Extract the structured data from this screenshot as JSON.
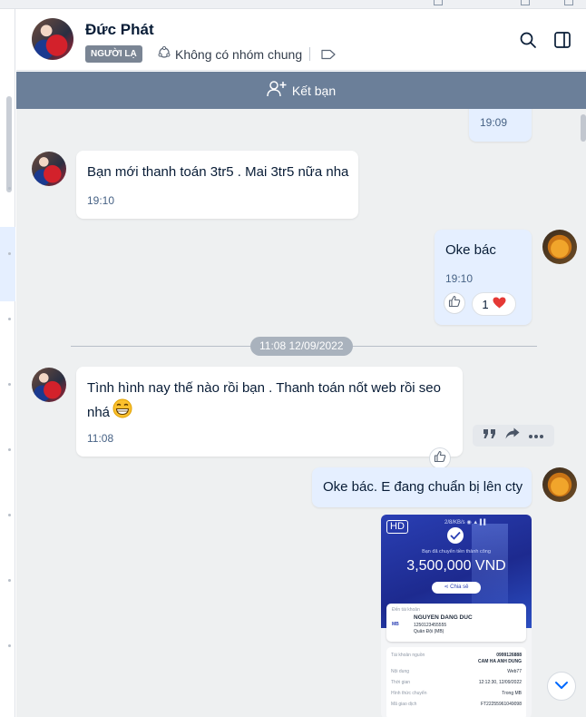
{
  "contact": {
    "name": "Đức Phát",
    "badge": "NGƯỜI LẠ",
    "group_status": "Không có nhóm chung"
  },
  "friend_bar": {
    "label": "Kết bạn"
  },
  "messages": [
    {
      "time": "19:09"
    },
    {
      "text": "Bạn mới thanh toán 3tr5 . Mai 3tr5 nữa nha",
      "time": "19:10"
    },
    {
      "text": "Oke bác",
      "time": "19:10",
      "reaction_count": "1"
    },
    {
      "text_line1": "Tình hình nay thế nào rồi bạn . Thanh toán nốt web rồi seo",
      "text_line2": "nhá",
      "time": "11:08"
    },
    {
      "text": "Oke bác. E đang chuẩn bị lên cty"
    }
  ],
  "date_divider": "11:08 12/09/2022",
  "receipt": {
    "hd_label": "HD",
    "status_bar": "2/8/KB/s ◉ ▲ ▌▌",
    "title": "Bạn đã chuyển tiền thành công",
    "amount": "3,500,000 VND",
    "share_label": "Chia sẻ",
    "to_label": "Đến tài khoản",
    "recipient_name": "NGUYEN DANG DUC",
    "recipient_account": "1250123455555",
    "recipient_bank": "Quân Đội (MB)",
    "bank_logo": "MB",
    "rows": [
      {
        "label": "Tài khoản nguồn",
        "value": "0999126888"
      },
      {
        "label": "",
        "value": "CAM HA ANH DUNG"
      },
      {
        "label": "Nội dung",
        "value": "Web77"
      },
      {
        "label": "Thời gian",
        "value": "12:12:30, 12/09/2022"
      },
      {
        "label": "Hình thức chuyển",
        "value": "Trong MB"
      },
      {
        "label": "Mã giao dịch",
        "value": "FT22255961049098"
      }
    ]
  },
  "icons": {
    "group": "group-icon",
    "tag": "tag-icon",
    "search": "search-icon",
    "panel": "panel-toggle-icon",
    "add_friend": "add-friend-icon",
    "like": "thumbs-up-icon",
    "heart": "heart-icon",
    "quote": "quote-icon",
    "forward": "forward-icon",
    "more": "more-icon",
    "scroll_down": "chevron-down-icon"
  },
  "colors": {
    "friend_bar": "#6b7f99",
    "out_bubble": "#e5efff",
    "chat_bg": "#eef0f1",
    "heart": "#e53935"
  }
}
